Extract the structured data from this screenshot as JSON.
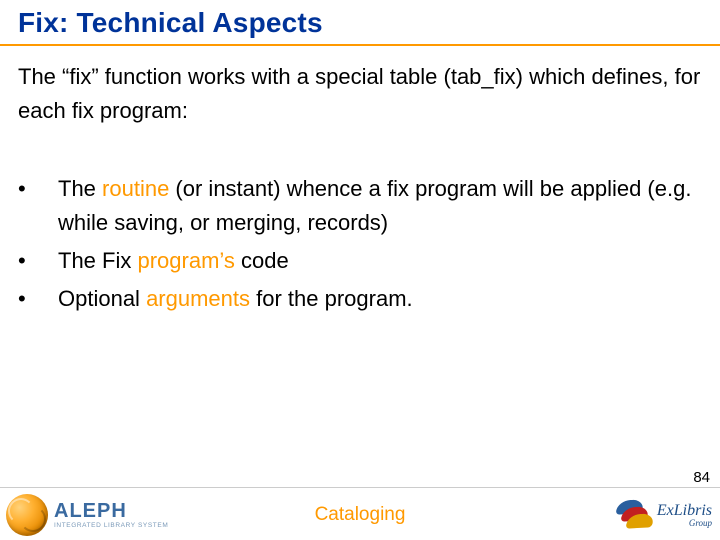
{
  "title": "Fix: Technical Aspects",
  "intro": "The “fix” function works with a special table (tab_fix) which defines, for each fix program:",
  "bullets": [
    {
      "pre": "The ",
      "hl": "routine",
      "post": " (or instant) whence a fix program will be applied (e.g. while saving, or merging, records)"
    },
    {
      "pre": "The Fix ",
      "hl": "program’s",
      "post": " code"
    },
    {
      "pre": "Optional ",
      "hl": "arguments",
      "post": " for the program."
    }
  ],
  "footer": {
    "center": "Cataloging",
    "page_number": "84",
    "aleph_title": "ALEPH",
    "aleph_sub": "INTEGRATED LIBRARY SYSTEM",
    "exlibris_main": "ExLibris",
    "exlibris_sub": "Group"
  }
}
